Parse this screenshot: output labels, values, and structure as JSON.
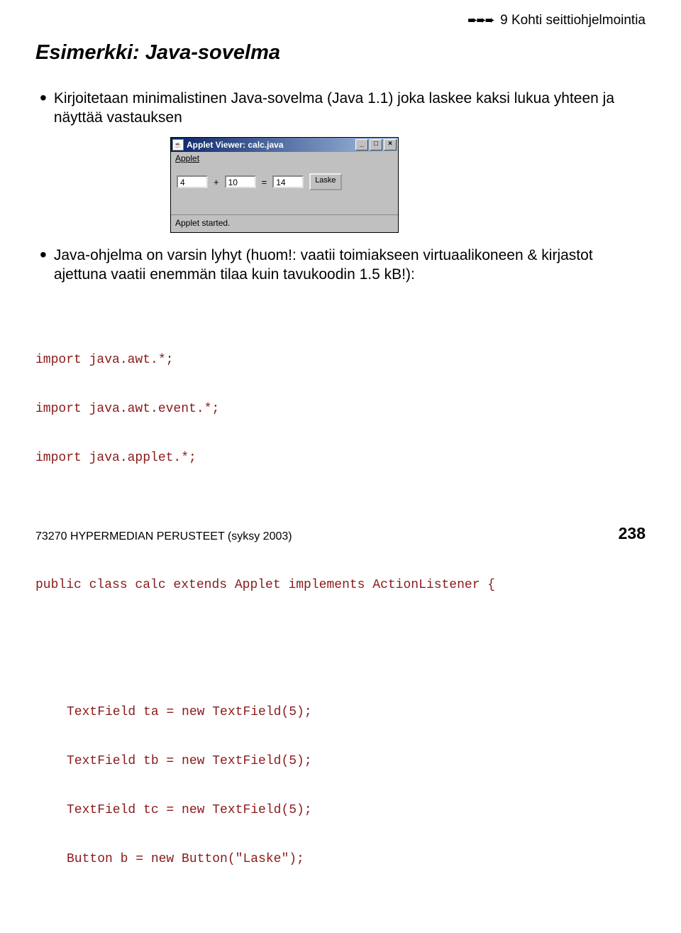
{
  "crumb": {
    "arrows": "➨➨➨",
    "text": "9 Kohti seittiohjelmointia"
  },
  "title": "Esimerkki: Java-sovelma",
  "bullet1": "Kirjoitetaan minimalistinen Java-sovelma (Java 1.1) joka laskee kaksi lukua yhteen ja näyttää vastauksen",
  "applet": {
    "title": "Applet Viewer: calc.java",
    "menu": "Applet",
    "menu_underlined": "A",
    "field_a": "4",
    "op_plus": "+",
    "field_b": "10",
    "op_eq": "=",
    "field_c": "14",
    "button": "Laske",
    "status": "Applet started.",
    "sysicon": "☕",
    "btn_min": "_",
    "btn_max": "□",
    "btn_close": "×"
  },
  "bullet2": "Java-ohjelma on varsin lyhyt (huom!: vaatii toimiakseen virtuaalikoneen & kirjastot ajettuna vaatii enemmän tilaa kuin tavukoodin 1.5 kB!):",
  "code": {
    "l1": "import java.awt.*;",
    "l2": "import java.awt.event.*;",
    "l3": "import java.applet.*;",
    "l4": "public class calc extends Applet implements ActionListener {",
    "l5": "TextField ta = new TextField(5);",
    "l6": "TextField tb = new TextField(5);",
    "l7": "TextField tc = new TextField(5);",
    "l8": "Button b = new Button(\"Laske\");"
  },
  "footer": {
    "left": "73270 HYPERMEDIAN PERUSTEET (syksy 2003)",
    "page": "238"
  }
}
